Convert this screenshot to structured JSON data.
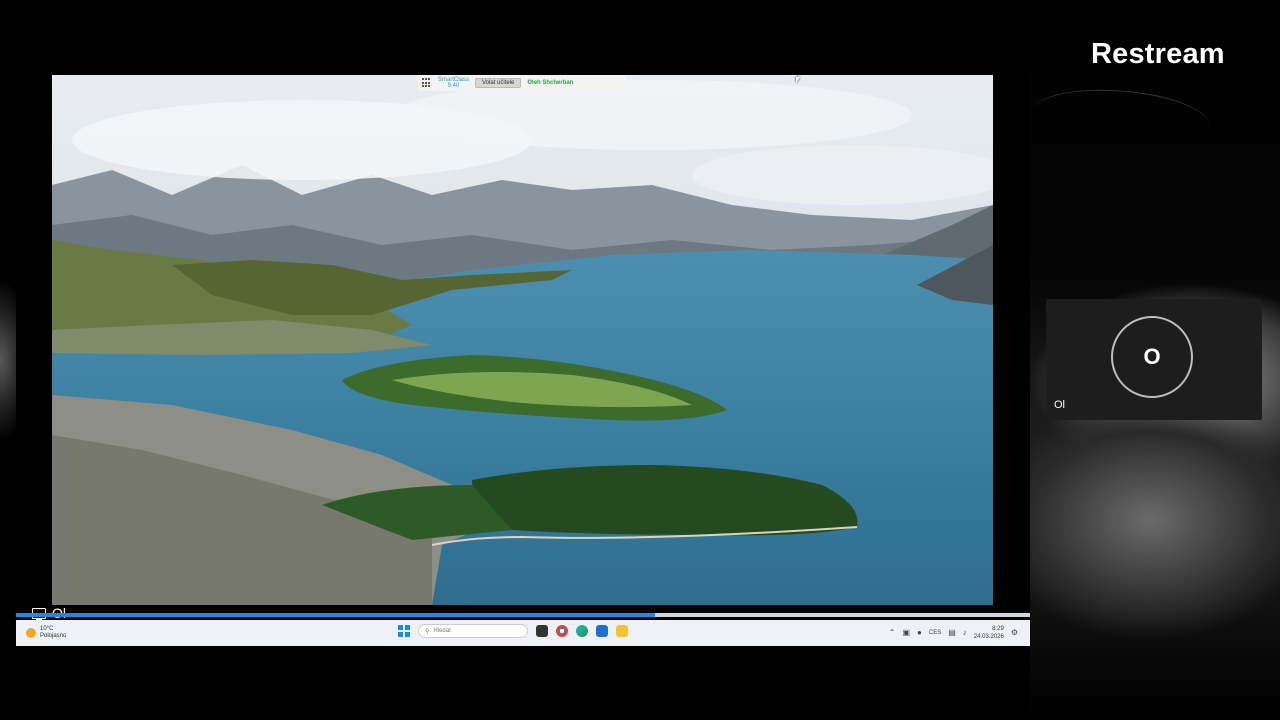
{
  "brand": {
    "name": "Restream"
  },
  "smartclass_toolbar": {
    "logo_label": "SmartClass",
    "logo_sub": "9.40",
    "button_label": "Volat učitele",
    "user_name": "Oleh Shcherban"
  },
  "screen_share": {
    "label": "Ol",
    "icon": "screen-share-icon",
    "progress_fraction": 0.63
  },
  "taskbar": {
    "weather_temp": "10°C",
    "weather_desc": "Polojasno",
    "search_placeholder": "Hledat",
    "tray_lang": "CES",
    "time": "8:29",
    "date": "24.03.2026",
    "apps": [
      "start-icon",
      "search-icon",
      "task-view-icon",
      "chrome-icon",
      "edge-icon",
      "store-icon",
      "file-explorer-icon"
    ]
  },
  "participant": {
    "initial": "O",
    "name": "Ol"
  }
}
